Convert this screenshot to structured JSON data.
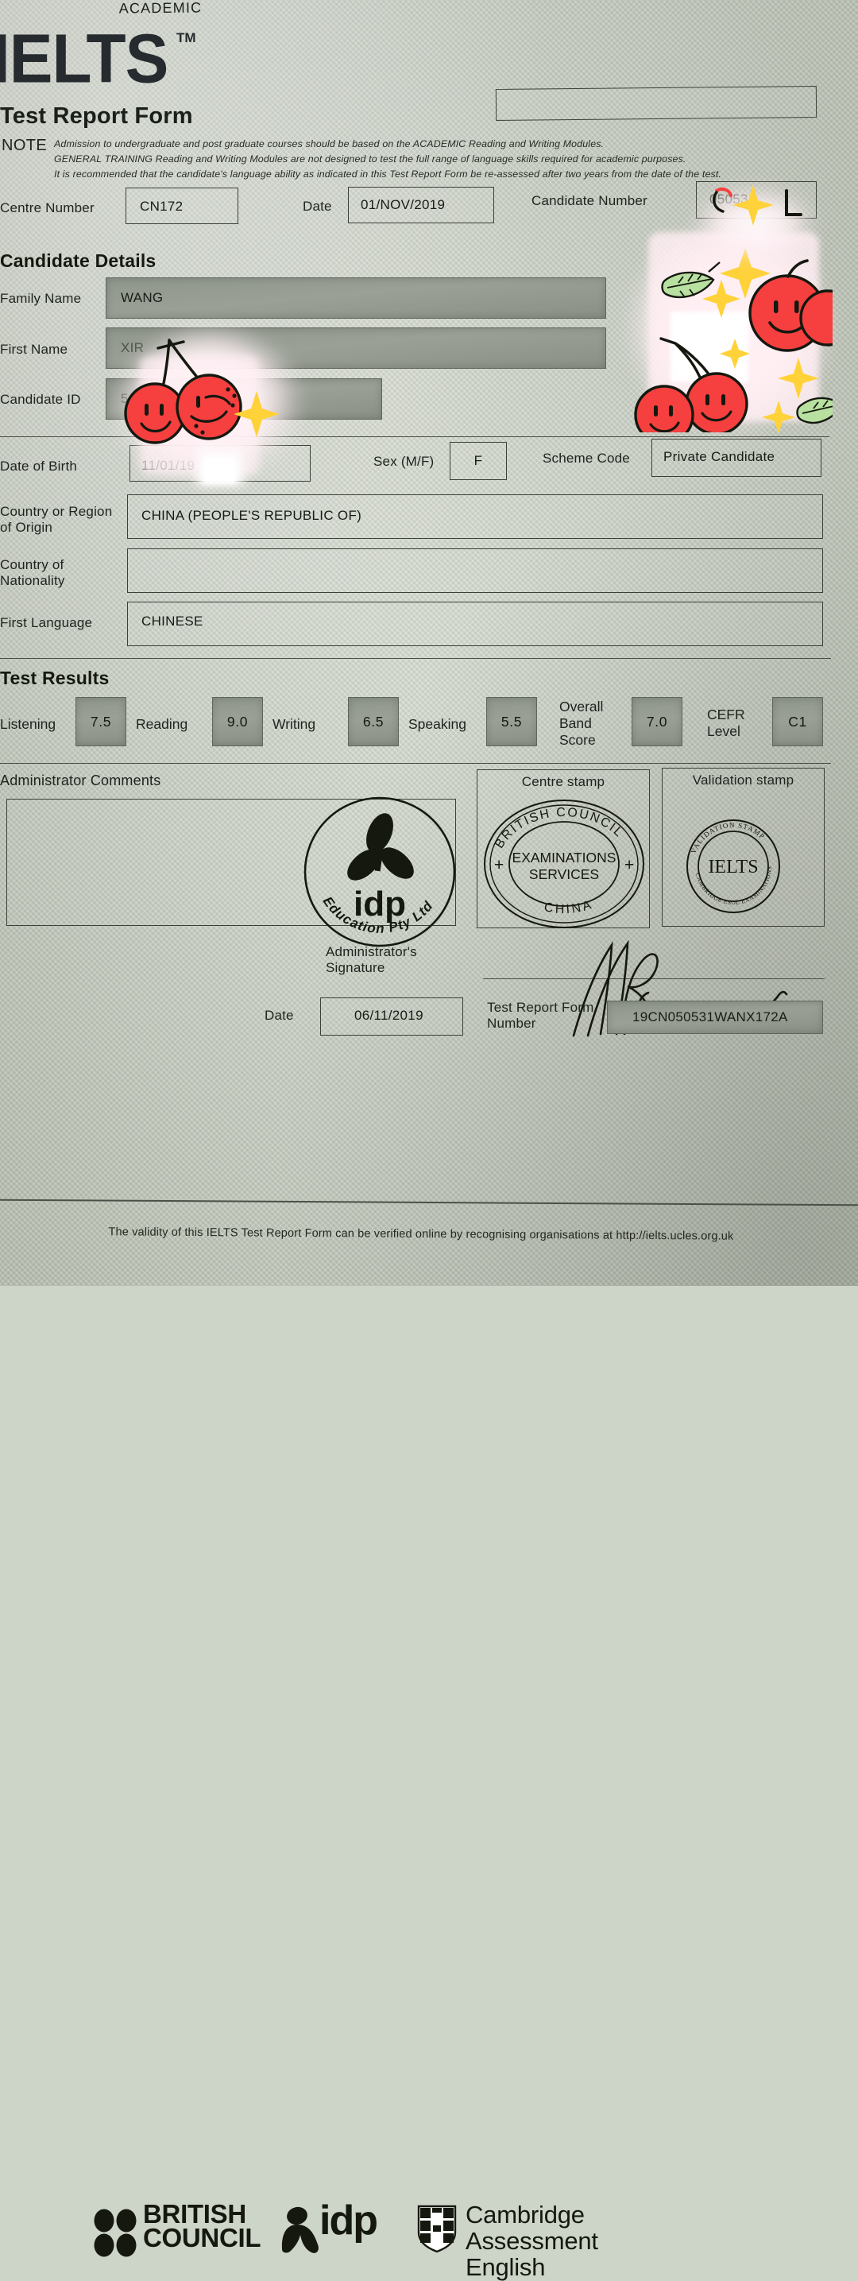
{
  "document": {
    "brand": "IELTS",
    "trademark": "TM",
    "title": "Test Report Form",
    "note_key": "NOTE",
    "note_lines": [
      "Admission to undergraduate and post graduate courses should be based on the ACADEMIC Reading and Writing Modules.",
      "GENERAL TRAINING Reading and Writing Modules are not designed to test the full range of language skills required for academic purposes.",
      "It is recommended that the candidate's language ability as indicated in this Test Report Form be re-assessed after two years from the date of the test."
    ],
    "module_type": "ACADEMIC"
  },
  "header": {
    "centre_number_label": "Centre Number",
    "centre_number_value": "CN172",
    "date_label": "Date",
    "date_value": "01/NOV/2019",
    "candidate_number_label": "Candidate Number",
    "candidate_number_value": "050531"
  },
  "candidate_details": {
    "section_title": "Candidate Details",
    "fields": [
      {
        "label": "Family Name",
        "value": "WANG"
      },
      {
        "label": "First Name",
        "value": "XIR"
      },
      {
        "label": "Candidate ID",
        "value": "51"
      }
    ],
    "dob_label": "Date of Birth",
    "dob_value": "11/01/19",
    "sex_label": "Sex (M/F)",
    "sex_value": "F",
    "scheme_label": "Scheme Code",
    "scheme_value": "Private Candidate",
    "origin_label": "Country or Region\nof Origin",
    "origin_value": "CHINA (PEOPLE'S REPUBLIC OF)",
    "nationality_label": "Country of\nNationality",
    "nationality_value": "",
    "language_label": "First Language",
    "language_value": "CHINESE"
  },
  "test_results": {
    "section_title": "Test Results",
    "items": [
      {
        "label": "Listening",
        "value": "7.5"
      },
      {
        "label": "Reading",
        "value": "9.0"
      },
      {
        "label": "Writing",
        "value": "6.5"
      },
      {
        "label": "Speaking",
        "value": "5.5"
      },
      {
        "label": "Overall\nBand\nScore",
        "value": "7.0"
      },
      {
        "label": "CEFR\nLevel",
        "value": "C1"
      }
    ]
  },
  "administration": {
    "admin_comments_label": "Administrator Comments",
    "admin_comments_value": "",
    "centre_stamp_label": "Centre stamp",
    "validation_stamp_label": "Validation stamp",
    "admin_signature_label": "Administrator's\nSignature",
    "date_label": "Date",
    "date_value": "06/11/2019",
    "trf_number_label": "Test Report Form\nNumber",
    "trf_number_value": "19CN050531WANX172A"
  },
  "stamps": {
    "idp_stamp_word": "idp",
    "idp_stamp_arc": "Education Pty Ltd",
    "centre_stamp_top_arc": "BRITISH  COUNCIL",
    "centre_stamp_line1": "EXAMINATIONS",
    "centre_stamp_line2": "SERVICES",
    "centre_stamp_bottom_arc": "CHINA",
    "centre_stamp_cross": "+",
    "validation_stamp_word": "IELTS",
    "validation_stamp_top_arc": "VALIDATION STAMP",
    "validation_stamp_bottom_arc": "CAMBRIDGE ESOL EXAMINATIONS"
  },
  "footer": {
    "british_council_line1": "BRITISH",
    "british_council_line2": "COUNCIL",
    "idp_word": "idp",
    "cambridge_line1": "Cambridge Assessment",
    "cambridge_line2": "English",
    "validity_note": "The validity of this IELTS Test Report Form can be verified online by recognising organisations at http://ielts.ucles.org.uk"
  },
  "colors": {
    "paper": "#cfd6c9",
    "ink": "#20241f",
    "shaded_field": "#929a8f",
    "sticker_red": "#f5403f",
    "sticker_yellow": "#ffd23a",
    "sticker_green": "#b8e0a0"
  }
}
